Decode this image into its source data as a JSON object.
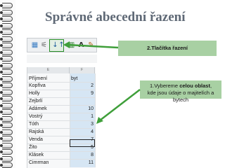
{
  "slide": {
    "title": "Správné abecední řazení"
  },
  "toolbar": {
    "icons": [
      "sort-ascending-icon",
      "sort-descending-icon",
      "chart-icon",
      "text-icon",
      "pencil-icon"
    ]
  },
  "callouts": {
    "step2": "2.Tlačítka řazení",
    "step1_line1_prefix": "1.Vybereme ",
    "step1_line1_bold": "celou oblast",
    "step1_line1_suffix": ",",
    "step1_line2": "kde jsou údaje o majitelích a bytech"
  },
  "sheet": {
    "column_headers": [
      "E",
      "F"
    ],
    "header_row": [
      "Příjmení",
      "byt"
    ],
    "rows": [
      {
        "name": "Kopřiva",
        "byt": "2"
      },
      {
        "name": "Holly",
        "byt": "9"
      },
      {
        "name": "Zejbrlí",
        "byt": ""
      },
      {
        "name": "Adámek",
        "byt": "10"
      },
      {
        "name": "Vostrý",
        "byt": "1"
      },
      {
        "name": "Tóth",
        "byt": "3"
      },
      {
        "name": "Rajská",
        "byt": "4"
      },
      {
        "name": "Venda",
        "byt": "7"
      },
      {
        "name": "Žito",
        "byt": "5"
      },
      {
        "name": "Klásek",
        "byt": "8"
      },
      {
        "name": "Cimrman",
        "byt": "11"
      }
    ]
  },
  "colors": {
    "callout": "#a8d0a3",
    "arrow": "#3f9f3a",
    "title": "#5f6976"
  }
}
